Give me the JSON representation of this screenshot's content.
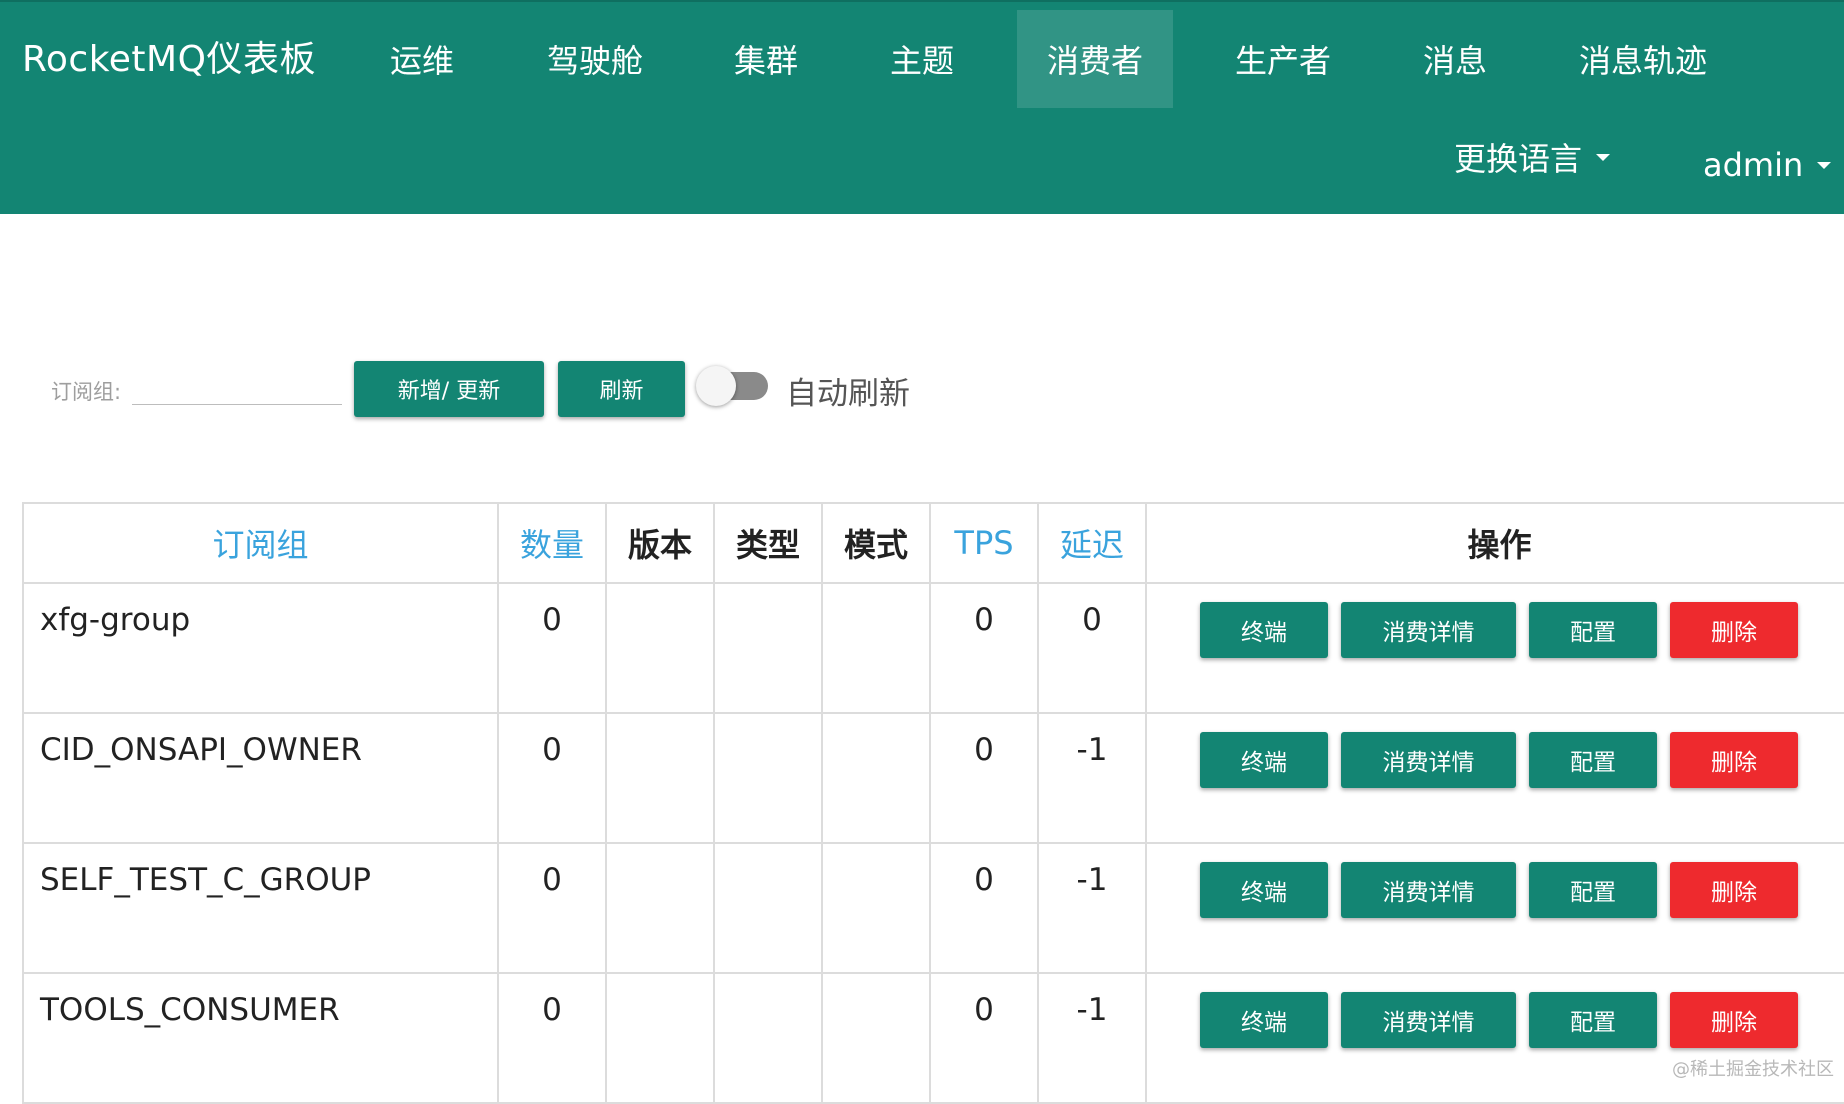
{
  "nav": {
    "brand": "RocketMQ仪表板",
    "items": [
      "运维",
      "驾驶舱",
      "集群",
      "主题",
      "消费者",
      "生产者",
      "消息",
      "消息轨迹"
    ],
    "active": "消费者",
    "language": "更换语言",
    "user": "admin"
  },
  "toolbar": {
    "search_label": "订阅组:",
    "search_value": "",
    "add_update": "新增/ 更新",
    "refresh": "刷新",
    "auto_refresh": "自动刷新",
    "auto_refresh_on": false
  },
  "table": {
    "headers": [
      "订阅组",
      "数量",
      "版本",
      "类型",
      "模式",
      "TPS",
      "延迟",
      "操作"
    ],
    "sortable_headers": [
      "订阅组",
      "数量",
      "TPS",
      "延迟"
    ],
    "rows": [
      {
        "group": "xfg-group",
        "count": "0",
        "version": "",
        "type": "",
        "mode": "",
        "tps": "0",
        "delay": "0"
      },
      {
        "group": "CID_ONSAPI_OWNER",
        "count": "0",
        "version": "",
        "type": "",
        "mode": "",
        "tps": "0",
        "delay": "-1"
      },
      {
        "group": "SELF_TEST_C_GROUP",
        "count": "0",
        "version": "",
        "type": "",
        "mode": "",
        "tps": "0",
        "delay": "-1"
      },
      {
        "group": "TOOLS_CONSUMER",
        "count": "0",
        "version": "",
        "type": "",
        "mode": "",
        "tps": "0",
        "delay": "-1"
      }
    ],
    "actions": {
      "client": "终端",
      "detail": "消费详情",
      "config": "配置",
      "delete": "删除"
    }
  },
  "colors": {
    "primary": "#138573",
    "danger": "#ee2a2e",
    "sortable_header": "#3aa3dd"
  },
  "watermark": "@稀土掘金技术社区"
}
